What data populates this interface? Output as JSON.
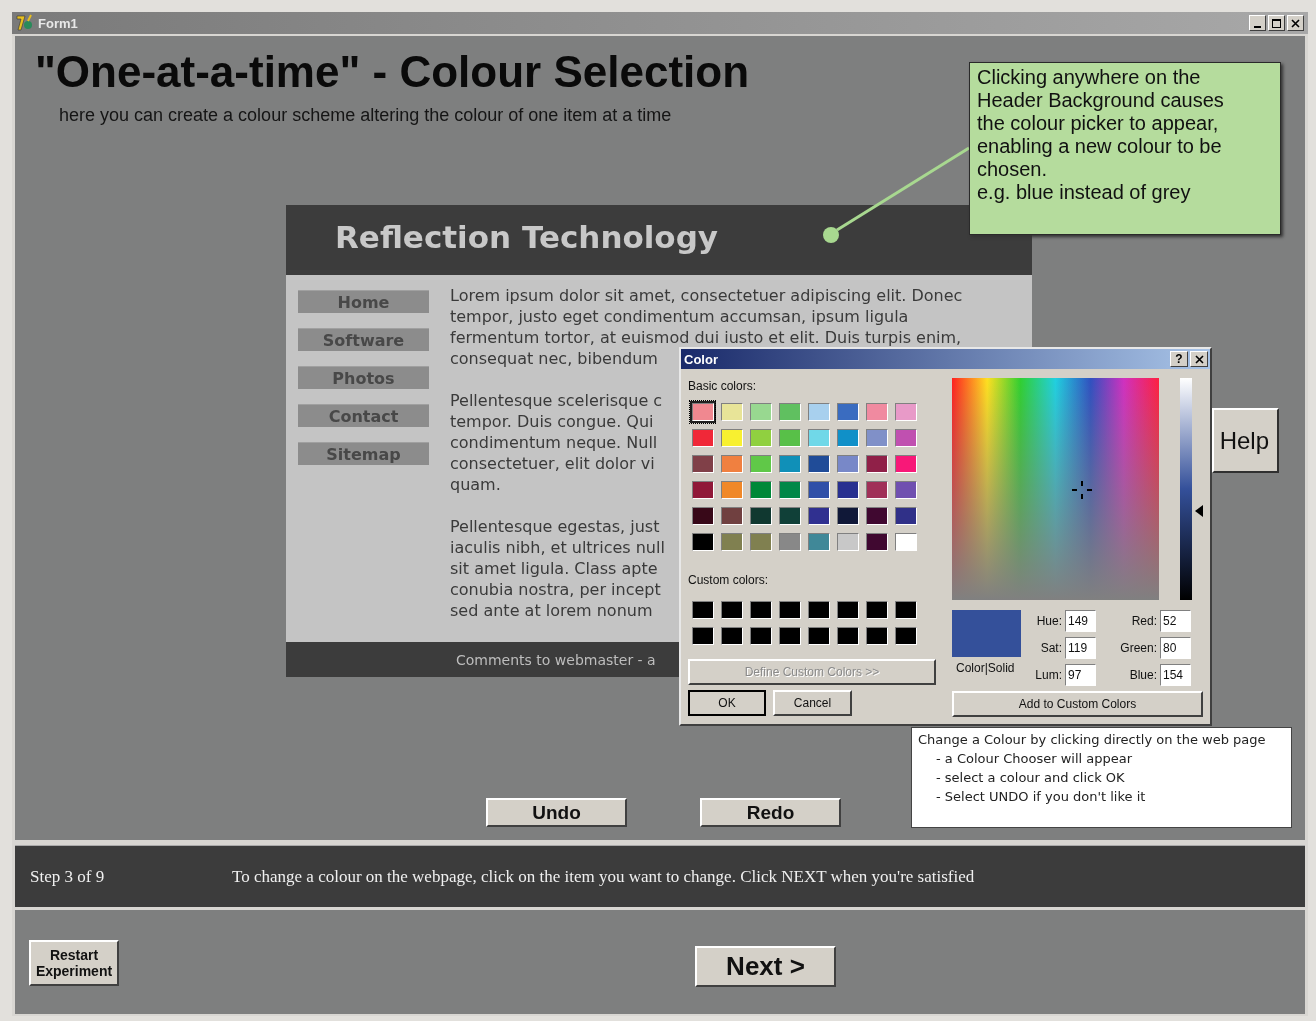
{
  "window": {
    "title": "Form1"
  },
  "header": {
    "title": "\"One-at-a-time\" - Colour Selection",
    "subtitle": "here you can create a colour scheme altering the colour of one item at a time"
  },
  "callout": {
    "lines": [
      "Clicking anywhere on the",
      "Header Background causes",
      "the colour picker to appear,",
      "enabling a new colour to be",
      "chosen.",
      "e.g. blue instead of grey"
    ]
  },
  "web_preview": {
    "title": "Reflection Technology",
    "nav": [
      "Home",
      "Software",
      "Photos",
      "Contact",
      "Sitemap"
    ],
    "paragraphs": [
      [
        "Lorem ipsum dolor sit amet, consectetuer adipiscing elit. Donec",
        "tempor, justo eget condimentum accumsan, ipsum ligula",
        "fermentum tortor, at euismod dui iusto et elit. Duis turpis enim,",
        "consequat nec, bibendum"
      ],
      [
        "Pellentesque scelerisque c",
        "tempor. Duis congue. Qui",
        "condimentum neque. Null",
        "consectetuer, elit dolor vi",
        "quam."
      ],
      [
        "Pellentesque egestas, just",
        "iaculis nibh, et ultrices null",
        "sit amet ligula. Class apte",
        "conubia nostra, per incept",
        "sed ante at lorem nonum"
      ]
    ],
    "footer": "Comments to webmaster - a"
  },
  "color_dialog": {
    "title": "Color",
    "help": "?",
    "basic_label": "Basic colors:",
    "basic_colors": [
      {
        "color": "#f08890",
        "selected": true
      },
      {
        "color": "#e8e498",
        "selected": false
      },
      {
        "color": "#98d890",
        "selected": false
      },
      {
        "color": "#60c060",
        "selected": false
      },
      {
        "color": "#a8d0ee",
        "selected": false
      },
      {
        "color": "#3a6cc0",
        "selected": false
      },
      {
        "color": "#f08aa0",
        "selected": false
      },
      {
        "color": "#e89ac8",
        "selected": false
      },
      {
        "color": "#f02838",
        "selected": false
      },
      {
        "color": "#f8f030",
        "selected": false
      },
      {
        "color": "#90d040",
        "selected": false
      },
      {
        "color": "#58c048",
        "selected": false
      },
      {
        "color": "#70d8e8",
        "selected": false
      },
      {
        "color": "#1090c8",
        "selected": false
      },
      {
        "color": "#8090c8",
        "selected": false
      },
      {
        "color": "#c050b0",
        "selected": false
      },
      {
        "color": "#804048",
        "selected": false
      },
      {
        "color": "#f08040",
        "selected": false
      },
      {
        "color": "#60c848",
        "selected": false
      },
      {
        "color": "#1090b8",
        "selected": false
      },
      {
        "color": "#204c98",
        "selected": false
      },
      {
        "color": "#7888c8",
        "selected": false
      },
      {
        "color": "#902048",
        "selected": false
      },
      {
        "color": "#f81878",
        "selected": false
      },
      {
        "color": "#901838",
        "selected": false
      },
      {
        "color": "#f08828",
        "selected": false
      },
      {
        "color": "#008838",
        "selected": false
      },
      {
        "color": "#008848",
        "selected": false
      },
      {
        "color": "#3050a8",
        "selected": false
      },
      {
        "color": "#283090",
        "selected": false
      },
      {
        "color": "#a03058",
        "selected": false
      },
      {
        "color": "#7050b0",
        "selected": false
      },
      {
        "color": "#380818",
        "selected": false
      },
      {
        "color": "#704040",
        "selected": false
      },
      {
        "color": "#103830",
        "selected": false
      },
      {
        "color": "#104038",
        "selected": false
      },
      {
        "color": "#303090",
        "selected": false
      },
      {
        "color": "#101838",
        "selected": false
      },
      {
        "color": "#400830",
        "selected": false
      },
      {
        "color": "#303088",
        "selected": false
      },
      {
        "color": "#000000",
        "selected": false
      },
      {
        "color": "#808050",
        "selected": false
      },
      {
        "color": "#808050",
        "selected": false
      },
      {
        "color": "#888888",
        "selected": false
      },
      {
        "color": "#408898",
        "selected": false
      },
      {
        "color": "#c8c8c8",
        "selected": false
      },
      {
        "color": "#400830",
        "selected": false
      },
      {
        "color": "#ffffff",
        "selected": false
      }
    ],
    "custom_label": "Custom colors:",
    "custom_colors": [
      {
        "color": "#000000"
      },
      {
        "color": "#000000"
      },
      {
        "color": "#000000"
      },
      {
        "color": "#000000"
      },
      {
        "color": "#000000"
      },
      {
        "color": "#000000"
      },
      {
        "color": "#000000"
      },
      {
        "color": "#000000"
      },
      {
        "color": "#000000"
      },
      {
        "color": "#000000"
      },
      {
        "color": "#000000"
      },
      {
        "color": "#000000"
      },
      {
        "color": "#000000"
      },
      {
        "color": "#000000"
      },
      {
        "color": "#000000"
      },
      {
        "color": "#000000"
      }
    ],
    "define_button": {
      "label": "Define Custom Colors >>",
      "disabled": true
    },
    "ok_button": "OK",
    "cancel_button": "Cancel",
    "preview": {
      "label": "Color|Solid",
      "color": "#34509a"
    },
    "hsl_fields": [
      {
        "label": "Hue:",
        "value": "149"
      },
      {
        "label": "Sat:",
        "value": "119"
      },
      {
        "label": "Lum:",
        "value": "97"
      }
    ],
    "rgb_fields": [
      {
        "label": "Red:",
        "value": "52"
      },
      {
        "label": "Green:",
        "value": "80"
      },
      {
        "label": "Blue:",
        "value": "154"
      }
    ],
    "add_button": "Add to Custom Colors"
  },
  "help_button": "Help",
  "hint": {
    "lines": [
      "Change a Colour by clicking directly on the web page",
      "- a Colour Chooser will appear",
      "- select a colour and click OK",
      "- Select UNDO if you don't like it"
    ]
  },
  "undo_button": "Undo",
  "redo_button": "Redo",
  "step_bar": {
    "step": "Step 3 of 9",
    "instruction": "To change a colour on the webpage, click on the item you want to change. Click NEXT when you're satisfied"
  },
  "restart_button": "Restart Experiment",
  "next_button": "Next >"
}
